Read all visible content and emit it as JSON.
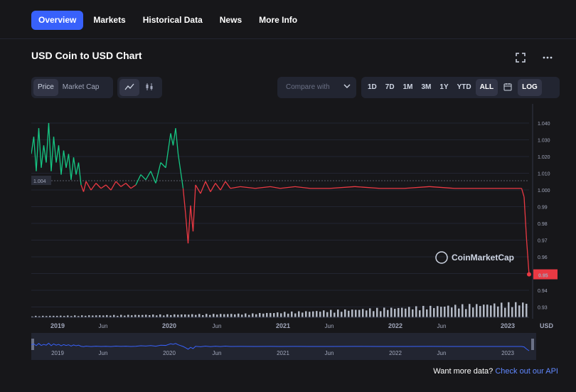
{
  "tabs": [
    {
      "label": "Overview",
      "active": true
    },
    {
      "label": "Markets"
    },
    {
      "label": "Historical Data"
    },
    {
      "label": "News"
    },
    {
      "label": "More Info"
    }
  ],
  "chart_title": "USD Coin to USD Chart",
  "toggles": {
    "price": "Price",
    "market_cap": "Market Cap"
  },
  "compare_placeholder": "Compare with",
  "ranges": [
    "1D",
    "7D",
    "1M",
    "3M",
    "1Y",
    "YTD",
    "ALL"
  ],
  "selected_range": "ALL",
  "log_label": "LOG",
  "icons": {
    "expand": "expand-icon",
    "more": "more-icon",
    "line": "line-chart-icon",
    "candle": "candlestick-icon",
    "calendar": "calendar-icon",
    "chevron": "chevron-down-icon"
  },
  "colors": {
    "accent": "#3861fb",
    "up": "#16c784",
    "down": "#ea3943",
    "volume": "#cfd6e4",
    "navigator": "#3861fb"
  },
  "watermark": "CoinMarketCap",
  "currency_label": "USD",
  "chart_data": {
    "type": "line",
    "title": "USD Coin to USD Chart",
    "reference_value": 1.004,
    "reference_label": "1.004",
    "current_value": 0.95,
    "current_label": "0.95",
    "y_ticks": [
      "1.040",
      "1.030",
      "1.020",
      "1.010",
      "1.000",
      "0.99",
      "0.98",
      "0.97",
      "0.96",
      "0.95",
      "0.94",
      "0.93"
    ],
    "x_ticks": [
      "2019",
      "Jun",
      "2020",
      "Jun",
      "2021",
      "Jun",
      "2022",
      "Jun",
      "2023"
    ],
    "ylim": [
      0.925,
      1.045
    ],
    "series": [
      {
        "points": [
          [
            0,
            1.02
          ],
          [
            0.005,
            1.03
          ],
          [
            0.01,
            1.01
          ],
          [
            0.015,
            1.035
          ],
          [
            0.02,
            1.012
          ],
          [
            0.025,
            1.025
          ],
          [
            0.03,
            1.015
          ],
          [
            0.035,
            1.038
          ],
          [
            0.04,
            1.01
          ],
          [
            0.045,
            1.03
          ],
          [
            0.05,
            1.015
          ],
          [
            0.055,
            1.025
          ],
          [
            0.06,
            1.008
          ],
          [
            0.065,
            1.022
          ],
          [
            0.07,
            1.012
          ],
          [
            0.075,
            1.02
          ],
          [
            0.08,
            1.005
          ],
          [
            0.085,
            1.018
          ],
          [
            0.09,
            1.008
          ],
          [
            0.095,
            1.015
          ],
          [
            0.1,
            1.002
          ],
          [
            0.105,
            0.998
          ],
          [
            0.11,
            1.004
          ],
          [
            0.12,
            0.999
          ],
          [
            0.13,
            1.003
          ],
          [
            0.14,
            1.0
          ],
          [
            0.15,
            1.002
          ],
          [
            0.16,
            0.999
          ],
          [
            0.17,
            1.004
          ],
          [
            0.18,
            1.001
          ],
          [
            0.19,
            1.003
          ],
          [
            0.2,
            1.0
          ],
          [
            0.21,
            1.002
          ],
          [
            0.22,
            1.008
          ],
          [
            0.23,
            1.005
          ],
          [
            0.24,
            1.01
          ],
          [
            0.25,
            1.003
          ],
          [
            0.26,
            1.015
          ],
          [
            0.27,
            1.012
          ],
          [
            0.28,
            1.032
          ],
          [
            0.285,
            1.025
          ],
          [
            0.29,
            1.035
          ],
          [
            0.295,
            1.02
          ],
          [
            0.3,
            1.01
          ],
          [
            0.305,
            1.0
          ],
          [
            0.31,
            0.985
          ],
          [
            0.315,
            0.968
          ],
          [
            0.32,
            0.99
          ],
          [
            0.325,
            0.975
          ],
          [
            0.33,
            1.002
          ],
          [
            0.34,
            0.997
          ],
          [
            0.35,
            1.004
          ],
          [
            0.36,
            0.998
          ],
          [
            0.37,
            1.003
          ],
          [
            0.38,
            0.999
          ],
          [
            0.39,
            1.004
          ],
          [
            0.4,
            1.0
          ],
          [
            0.42,
            1.001
          ],
          [
            0.45,
            1.0
          ],
          [
            0.48,
            1.001
          ],
          [
            0.5,
            1.0
          ],
          [
            0.53,
            1.001
          ],
          [
            0.56,
            1.0
          ],
          [
            0.6,
            1.0
          ],
          [
            0.65,
            1.001
          ],
          [
            0.7,
            1.0
          ],
          [
            0.75,
            1.0
          ],
          [
            0.8,
            1.001
          ],
          [
            0.85,
            1.0
          ],
          [
            0.9,
            1.0
          ],
          [
            0.95,
            1.0
          ],
          [
            0.985,
            1.0
          ],
          [
            0.99,
            0.995
          ],
          [
            0.995,
            0.97
          ],
          [
            1.0,
            0.95
          ]
        ]
      }
    ]
  },
  "footer": {
    "text": "Want more data?",
    "link": "Check out our API"
  }
}
